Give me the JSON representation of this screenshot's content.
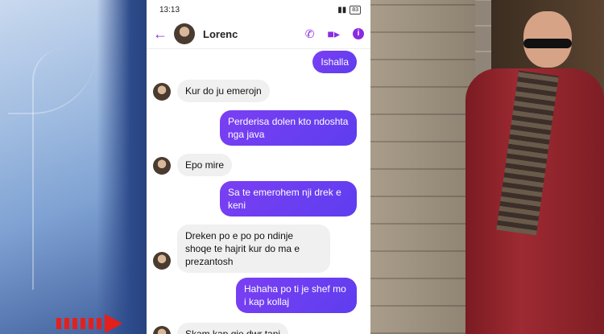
{
  "status_bar": {
    "time": "13:13",
    "battery": "83"
  },
  "header": {
    "contact_name": "Lorenc"
  },
  "messages": [
    {
      "side": "out",
      "text": "Ishalla"
    },
    {
      "side": "in",
      "text": "Kur do ju emerojn"
    },
    {
      "side": "out",
      "text": "Perderisa dolen kto ndoshta nga java"
    },
    {
      "side": "in",
      "text": "Epo mire"
    },
    {
      "side": "out",
      "text": "Sa te emerohem nji drek e keni"
    },
    {
      "side": "in",
      "text": "Dreken po e po po ndinje shoqe te hajrit kur do ma e prezantosh"
    },
    {
      "side": "out",
      "text": "Hahaha po ti je shef mo i kap kollaj"
    },
    {
      "side": "in",
      "text": "Skam kap gje dwr tani"
    }
  ],
  "colors": {
    "accent": "#8a2be2",
    "outgoing_bubble": "#6a3ef1",
    "incoming_bubble": "#f0f0f0",
    "arrow": "#e3201b"
  }
}
